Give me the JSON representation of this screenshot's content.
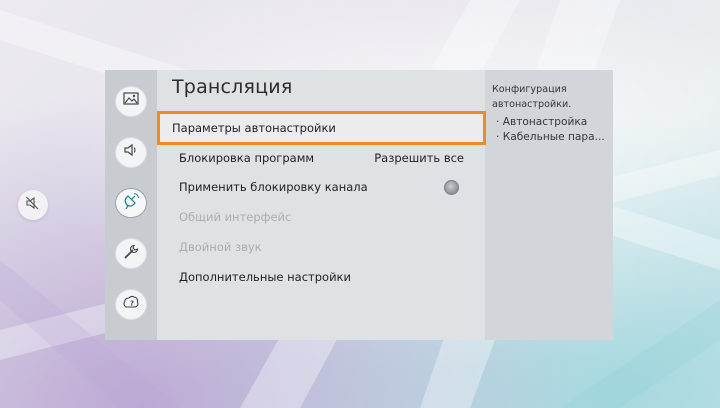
{
  "panel": {
    "title": "Трансляция",
    "menu": [
      {
        "label": "Параметры автонастройки",
        "value": "",
        "state": "focused"
      },
      {
        "label": "Блокировка программ",
        "value": "Разрешить все",
        "state": "normal"
      },
      {
        "label": "Применить блокировку канала",
        "value": "",
        "state": "toggle-off"
      },
      {
        "label": "Общий интерфейс",
        "value": "",
        "state": "disabled"
      },
      {
        "label": "Двойной звук",
        "value": "",
        "state": "disabled"
      },
      {
        "label": "Дополнительные настройки",
        "value": "",
        "state": "normal"
      }
    ]
  },
  "description": {
    "line1": "Конфигурация",
    "line2": "автонастройки.",
    "item1": "· Автонастройка",
    "item2": "· Кабельные пара..."
  },
  "icons": {
    "mute": "volume-mute-icon",
    "categories": [
      "picture-icon",
      "sound-icon",
      "broadcast-icon",
      "general-icon",
      "support-icon"
    ]
  },
  "colors": {
    "focus_border": "#f08a24",
    "sidebar_bg": "#c8ccd1",
    "menu_bg": "#dfe2e5",
    "description_bg": "#d2d6da"
  }
}
